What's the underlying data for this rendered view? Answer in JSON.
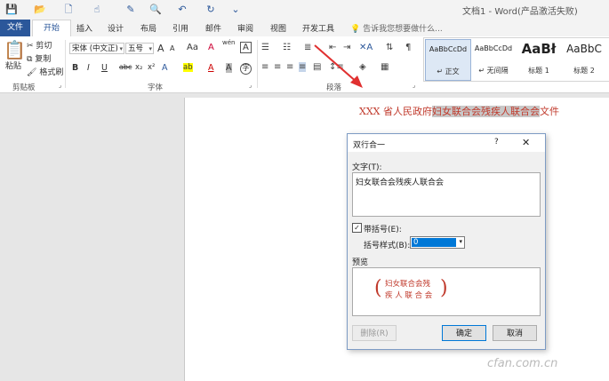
{
  "window": {
    "title": "文档1 - Word(产品激活失败)"
  },
  "qat": {
    "icons": [
      "save-icon",
      "open-icon",
      "new-icon",
      "touch-icon",
      "format-painter-icon",
      "print-preview-icon",
      "undo-icon",
      "redo-icon",
      "customize-icon"
    ],
    "glyphs": [
      "💾",
      "📂",
      "🗋",
      "☝",
      "✎",
      "🔍",
      "↶",
      "↻",
      "⌄"
    ]
  },
  "tabs": {
    "file": "文件",
    "active": "开始",
    "others": [
      "插入",
      "设计",
      "布局",
      "引用",
      "邮件",
      "审阅",
      "视图",
      "开发工具"
    ],
    "tell_me": "告诉我您想要做什么..."
  },
  "clipboard": {
    "paste": "粘贴",
    "cut": "剪切",
    "copy": "复制",
    "format_painter": "格式刷",
    "label": "剪贴板"
  },
  "font": {
    "name": "宋体 (中文正)",
    "size": "五号",
    "grow": "A",
    "shrink": "A",
    "case": "Aa",
    "clear": "A",
    "pinyin": "wén",
    "border": "A",
    "bold": "B",
    "italic": "I",
    "underline": "U",
    "strike": "abc",
    "sub": "x₂",
    "sup": "x²",
    "effects": "A",
    "highlight": "ab",
    "color": "A",
    "shade": "A",
    "circle": "字",
    "label": "字体"
  },
  "paragraph": {
    "label": "段落"
  },
  "styles": [
    {
      "sample": "AaBbCcDd",
      "name": "↵ 正文"
    },
    {
      "sample": "AaBbCcDd",
      "name": "↵ 无间隔"
    },
    {
      "sample": "AaBł",
      "name": "标题 1"
    },
    {
      "sample": "AaBbC",
      "name": "标题 2"
    }
  ],
  "document": {
    "prefix": "XXX 省人民政府",
    "highlighted": "妇女联合会残疾人联合会",
    "suffix": "文件"
  },
  "dialog": {
    "title": "双行合一",
    "help": "?",
    "close": "✕",
    "text_label": "文字(T):",
    "text_value": "妇女联合会残疾人联合会",
    "bracket_checkbox_label": "带括号(E):",
    "bracket_checked": "✓",
    "bracket_style_label": "括号样式(B):",
    "bracket_style_value": "0",
    "preview_label": "预览",
    "preview_open": "(",
    "preview_close": ")",
    "preview_line1": "妇女联合会残",
    "preview_line2": "疾 人 联 合 会",
    "delete_button": "删除(R)",
    "ok_button": "确定",
    "cancel_button": "取消"
  },
  "colors": {
    "accent": "#2b579a",
    "doc_text": "#c0392b",
    "arrow": "#e03030"
  },
  "watermark": "cfan.com.cn"
}
